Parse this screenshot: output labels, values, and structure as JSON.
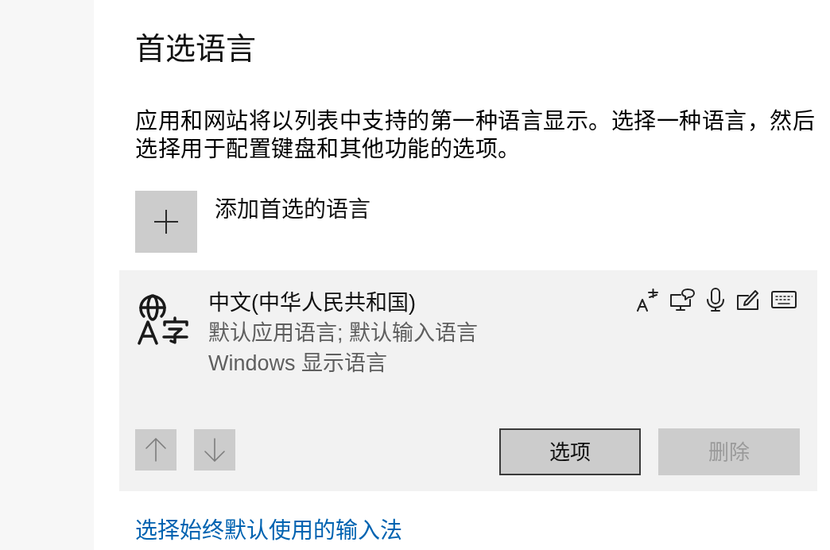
{
  "heading": "首选语言",
  "description": "应用和网站将以列表中支持的第一种语言显示。选择一种语言，然后选择用于配置键盘和其他功能的选项。",
  "add_language_button": {
    "label": "添加首选的语言"
  },
  "languages": [
    {
      "name": "中文(中华人民共和国)",
      "details": [
        "默认应用语言; 默认输入语言",
        "Windows 显示语言"
      ],
      "selected": true
    }
  ],
  "move_up_button": {
    "disabled": true
  },
  "move_down_button": {
    "disabled": true
  },
  "options_button": {
    "label": "选项",
    "disabled": false,
    "focused": true
  },
  "remove_button": {
    "label": "删除",
    "disabled": true
  },
  "link": "选择始终默认使用的输入法"
}
